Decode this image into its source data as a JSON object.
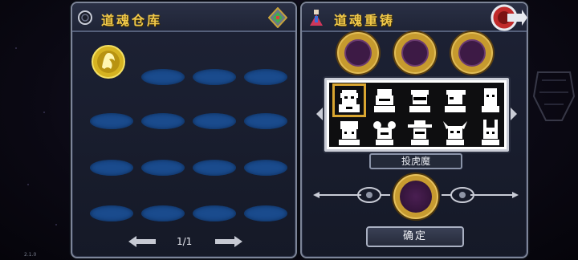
{
  "left_panel": {
    "title": "道魂仓库",
    "page_indicator": "1/1"
  },
  "right_panel": {
    "title": "道魂重铸",
    "selected_name": "投虎魔",
    "confirm_label": "确定"
  },
  "version": "2.1.0",
  "colors": {
    "title_gold": "#f0c84a",
    "slot_blue": "#1a4b8d",
    "socket_gold": "#c69a2e",
    "socket_purple": "#3d1a45"
  },
  "icons": [
    "settings-ring-icon",
    "gem-icon",
    "character-icon",
    "back-arrow-icon",
    "prev-page-arrow-icon",
    "next-page-arrow-icon",
    "wing-ornament-left-icon",
    "wing-ornament-right-icon"
  ]
}
